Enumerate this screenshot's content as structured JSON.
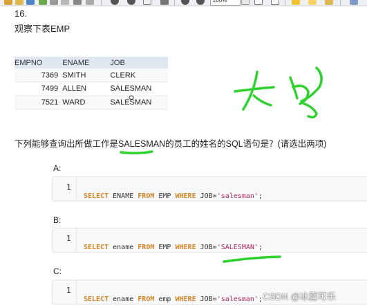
{
  "toolbar": {
    "zoom_label": "200%",
    "colors": [
      "#d9a33a",
      "#4f86c6",
      "#6aa84f",
      "#e06666",
      "#8e7cc3",
      "#999999"
    ]
  },
  "question_number": "16.",
  "table_intro": "观察下表EMP",
  "emp_table": {
    "headers": [
      "EMPNO",
      "ENAME",
      "JOB"
    ],
    "rows": [
      [
        "7369",
        "SMITH",
        "CLERK"
      ],
      [
        "7499",
        "ALLEN",
        "SALESMAN"
      ],
      [
        "7521",
        "WARD",
        "SALESMAN"
      ]
    ]
  },
  "question": {
    "before": "下列能够查询出所做工作是",
    "highlight": "SALESMAN",
    "after": "的员工的姓名的SQL语句是？(请选出两项)"
  },
  "options": [
    {
      "label": "A:",
      "line_number": "1",
      "tokens": [
        {
          "t": "SELECT",
          "k": "kw"
        },
        {
          "t": " ENAME ",
          "k": ""
        },
        {
          "t": "FROM",
          "k": "kw"
        },
        {
          "t": " EMP ",
          "k": ""
        },
        {
          "t": "WHERE",
          "k": "kw"
        },
        {
          "t": " JOB=",
          "k": ""
        },
        {
          "t": "'salesman'",
          "k": "str"
        },
        {
          "t": ";",
          "k": ""
        }
      ]
    },
    {
      "label": "B:",
      "line_number": "1",
      "tokens": [
        {
          "t": "SELECT",
          "k": "kw"
        },
        {
          "t": " ename ",
          "k": ""
        },
        {
          "t": "FROM",
          "k": "kw"
        },
        {
          "t": " EMP ",
          "k": ""
        },
        {
          "t": "WHERE",
          "k": "kw"
        },
        {
          "t": " JOB=",
          "k": ""
        },
        {
          "t": "'SALESMAN'",
          "k": "str"
        },
        {
          "t": ";",
          "k": ""
        }
      ]
    },
    {
      "label": "C:",
      "line_number": "1",
      "tokens": [
        {
          "t": "SELECT",
          "k": "kw"
        },
        {
          "t": " ename ",
          "k": ""
        },
        {
          "t": "FROM",
          "k": "kw"
        },
        {
          "t": " emp ",
          "k": ""
        },
        {
          "t": "WHERE",
          "k": "kw"
        },
        {
          "t": " JOB=",
          "k": ""
        },
        {
          "t": "'salesman'",
          "k": "str"
        },
        {
          "t": ";",
          "k": ""
        }
      ]
    }
  ],
  "annotation_color": "#2ed12e",
  "watermark": "CSDN @冰露可乐"
}
